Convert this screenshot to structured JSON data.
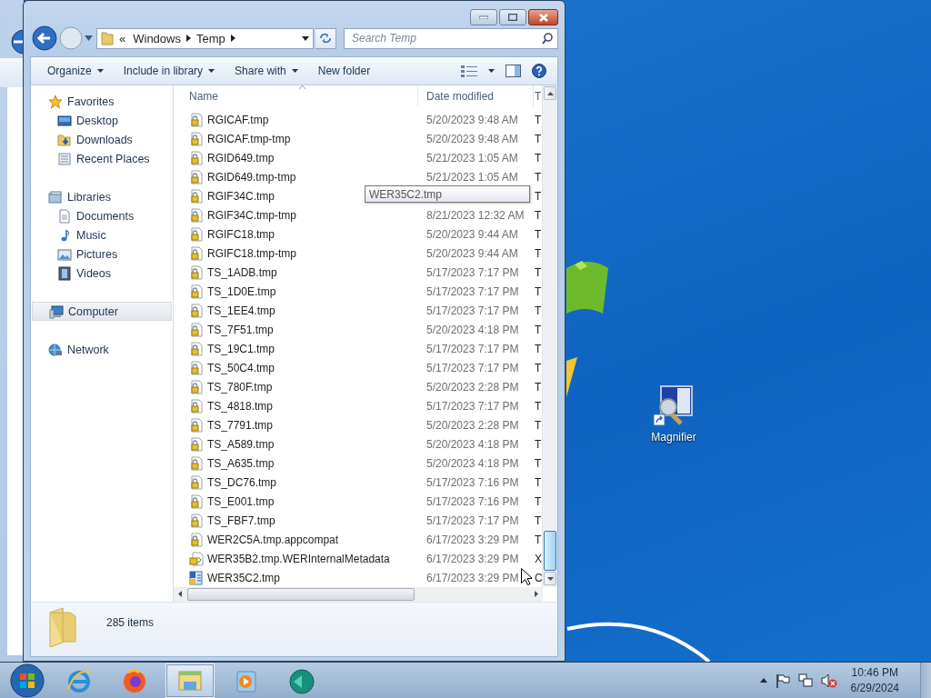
{
  "explorer": {
    "address": {
      "overflow": "«",
      "crumbs": [
        "Windows",
        "Temp"
      ]
    },
    "search": {
      "placeholder": "Search Temp"
    },
    "toolbar": [
      {
        "label": "Organize",
        "dropdown": true
      },
      {
        "label": "Include in library",
        "dropdown": true
      },
      {
        "label": "Share with",
        "dropdown": true
      },
      {
        "label": "New folder",
        "dropdown": false
      }
    ],
    "navigation": [
      {
        "kind": "star",
        "label": "Favorites",
        "selected": false,
        "children": [
          {
            "kind": "desktop",
            "label": "Desktop",
            "selected": false
          },
          {
            "kind": "downloads",
            "label": "Downloads",
            "selected": false
          },
          {
            "kind": "recent",
            "label": "Recent Places",
            "selected": false
          }
        ]
      },
      {
        "kind": "library",
        "label": "Libraries",
        "selected": false,
        "children": [
          {
            "kind": "documents",
            "label": "Documents",
            "selected": false
          },
          {
            "kind": "music",
            "label": "Music",
            "selected": false
          },
          {
            "kind": "pictures",
            "label": "Pictures",
            "selected": false
          },
          {
            "kind": "videos",
            "label": "Videos",
            "selected": false
          }
        ]
      },
      {
        "kind": "computer",
        "label": "Computer",
        "selected": true
      },
      {
        "kind": "network",
        "label": "Network",
        "selected": false
      }
    ],
    "file_list": {
      "columns": [
        "Name",
        "Date modified",
        "T"
      ],
      "rows": [
        {
          "kind": "locked",
          "name": "RGICAF.tmp",
          "date": "5/20/2023 9:48 AM",
          "column_3": "T",
          "selected": false
        },
        {
          "kind": "locked",
          "name": "RGICAF.tmp-tmp",
          "date": "5/20/2023 9:48 AM",
          "column_3": "T",
          "selected": false
        },
        {
          "kind": "locked",
          "name": "RGID649.tmp",
          "date": "5/21/2023 1:05 AM",
          "column_3": "T",
          "selected": false
        },
        {
          "kind": "locked",
          "name": "RGID649.tmp-tmp",
          "date": "5/21/2023 1:05 AM",
          "column_3": "T",
          "selected": false
        },
        {
          "kind": "locked",
          "name": "RGIF34C.tmp",
          "column_3": "T",
          "selected": false
        },
        {
          "kind": "locked",
          "name": "RGIF34C.tmp-tmp",
          "date": "8/21/2023 12:32 AM",
          "column_3": "T",
          "selected": false
        },
        {
          "kind": "locked",
          "name": "RGIFC18.tmp",
          "date": "5/20/2023 9:44 AM",
          "column_3": "T",
          "selected": false
        },
        {
          "kind": "locked",
          "name": "RGIFC18.tmp-tmp",
          "date": "5/20/2023 9:44 AM",
          "column_3": "T",
          "selected": false
        },
        {
          "kind": "locked",
          "name": "TS_1ADB.tmp",
          "date": "5/17/2023 7:17 PM",
          "column_3": "T",
          "selected": false
        },
        {
          "kind": "locked",
          "name": "TS_1D0E.tmp",
          "date": "5/17/2023 7:17 PM",
          "column_3": "T",
          "selected": false
        },
        {
          "kind": "locked",
          "name": "TS_1EE4.tmp",
          "date": "5/17/2023 7:17 PM",
          "column_3": "T",
          "selected": false
        },
        {
          "kind": "locked",
          "name": "TS_7F51.tmp",
          "date": "5/20/2023 4:18 PM",
          "column_3": "T",
          "selected": false
        },
        {
          "kind": "locked",
          "name": "TS_19C1.tmp",
          "date": "5/17/2023 7:17 PM",
          "column_3": "T",
          "selected": false
        },
        {
          "kind": "locked",
          "name": "TS_50C4.tmp",
          "date": "5/17/2023 7:17 PM",
          "column_3": "T",
          "selected": false
        },
        {
          "kind": "locked",
          "name": "TS_780F.tmp",
          "date": "5/20/2023 2:28 PM",
          "column_3": "T",
          "selected": false
        },
        {
          "kind": "locked",
          "name": "TS_4818.tmp",
          "date": "5/17/2023 7:17 PM",
          "column_3": "T",
          "selected": false
        },
        {
          "kind": "locked",
          "name": "TS_7791.tmp",
          "date": "5/20/2023 2:28 PM",
          "column_3": "T",
          "selected": false
        },
        {
          "kind": "locked",
          "name": "TS_A589.tmp",
          "date": "5/20/2023 4:18 PM",
          "column_3": "T",
          "selected": false
        },
        {
          "kind": "locked",
          "name": "TS_A635.tmp",
          "date": "5/20/2023 4:18 PM",
          "column_3": "T",
          "selected": false
        },
        {
          "kind": "locked",
          "name": "TS_DC76.tmp",
          "date": "5/17/2023 7:16 PM",
          "column_3": "T",
          "selected": false
        },
        {
          "kind": "locked",
          "name": "TS_E001.tmp",
          "date": "5/17/2023 7:16 PM",
          "column_3": "T",
          "selected": false
        },
        {
          "kind": "locked",
          "name": "TS_FBF7.tmp",
          "date": "5/17/2023 7:17 PM",
          "column_3": "T",
          "selected": false
        },
        {
          "kind": "locked",
          "name": "WER2C5A.tmp.appcompat",
          "date": "6/17/2023 3:29 PM",
          "column_3": "T",
          "selected": false
        },
        {
          "kind": "metadata",
          "name": "WER35B2.tmp.WERInternalMetadata",
          "date": "6/17/2023 3:29 PM",
          "column_3": "X",
          "selected": false
        },
        {
          "kind": "report",
          "name": "WER35C2.tmp",
          "date": "6/17/2023 3:29 PM",
          "column_3": "C",
          "selected": false
        }
      ]
    },
    "tooltip": {
      "text": "WER35C2.tmp"
    },
    "status": {
      "item_count": "285 items"
    }
  },
  "desktop_icons": [
    {
      "label": "Magnifier"
    }
  ],
  "taskbar": {
    "buttons": [
      {
        "kind": "ie",
        "active": false
      },
      {
        "kind": "firefox",
        "active": false
      },
      {
        "kind": "explorer",
        "active": true
      },
      {
        "kind": "media",
        "active": false
      },
      {
        "kind": "teal",
        "active": false
      }
    ],
    "clock": {
      "time": "10:46 PM",
      "date": "6/29/2024"
    }
  }
}
